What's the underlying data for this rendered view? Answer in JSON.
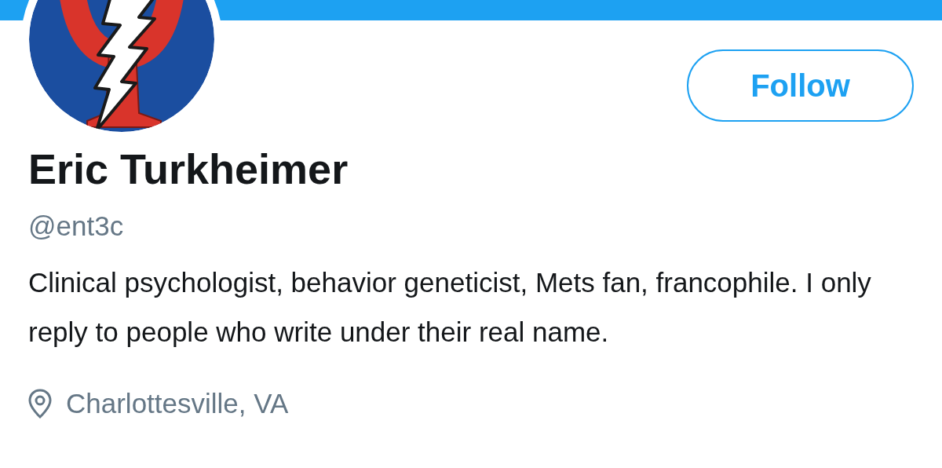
{
  "profile": {
    "name": "Eric Turkheimer",
    "handle": "@ent3c",
    "bio": "Clinical psychologist, behavior geneticist, Mets fan, francophile. I only reply to people who write under their real name.",
    "location": "Charlottesville, VA"
  },
  "follow_button": {
    "label": "Follow"
  }
}
